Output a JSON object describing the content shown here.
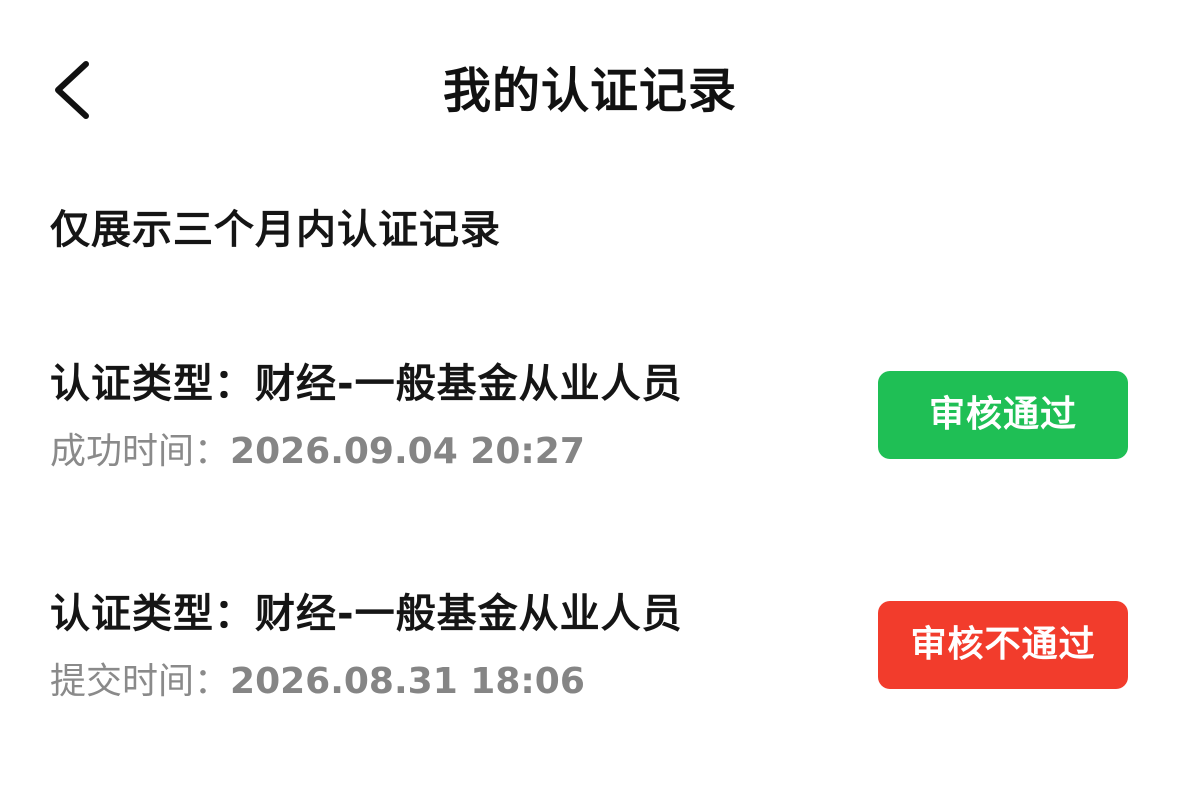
{
  "header": {
    "title": "我的认证记录",
    "back_icon": "chevron-left-icon"
  },
  "notice": "仅展示三个月内认证记录",
  "records": [
    {
      "type_label": "认证类型：",
      "type_value": "财经-一般基金从业人员",
      "time_label": "成功时间：",
      "time_value": "2026.09.04 20:27",
      "status_label": "审核通过",
      "status_color": "#1fbf55"
    },
    {
      "type_label": "认证类型：",
      "type_value": "财经-一般基金从业人员",
      "time_label": "提交时间：",
      "time_value": "2026.08.31 18:06",
      "status_label": "审核不通过",
      "status_color": "#f23c2c"
    }
  ]
}
